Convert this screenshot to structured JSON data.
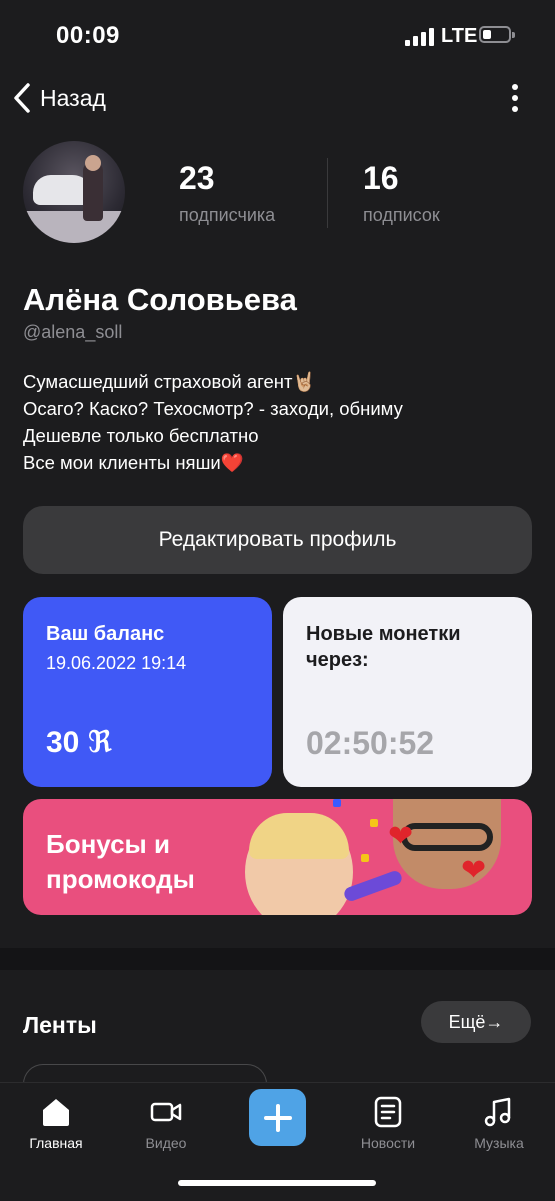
{
  "status_bar": {
    "time": "00:09",
    "network": "LTE"
  },
  "nav": {
    "back_label": "Назад"
  },
  "profile": {
    "followers_count": "23",
    "followers_label": "подписчика",
    "following_count": "16",
    "following_label": "подписок",
    "name": "Алёна Соловьева",
    "handle": "@alena_soll",
    "bio": [
      "Сумасшедший страховой агент🤘🏼",
      "Осаго? Каско? Техосмотр? - заходи, обниму",
      "Дешевле только бесплатно",
      "Все мои клиенты няши❤️"
    ],
    "edit_label": "Редактировать профиль"
  },
  "balance_card": {
    "title": "Ваш баланс",
    "date": "19.06.2022 19:14",
    "value": "30 ℜ"
  },
  "timer_card": {
    "title_line1": "Новые монетки",
    "title_line2": "через:",
    "value": "02:50:52"
  },
  "bonus_card": {
    "line1": "Бонусы и",
    "line2": "промокоды"
  },
  "feeds": {
    "title": "Ленты",
    "more_label": "Ещё→"
  },
  "tabbar": {
    "items": [
      {
        "label": "Главная",
        "icon": "home-icon"
      },
      {
        "label": "Видео",
        "icon": "video-icon"
      },
      {
        "label": "",
        "icon": "plus-icon"
      },
      {
        "label": "Новости",
        "icon": "news-icon"
      },
      {
        "label": "Музыка",
        "icon": "music-icon"
      }
    ]
  },
  "colors": {
    "balance_card": "#4059f6",
    "bonus_card": "#e94f7e",
    "plus_button": "#4fa3e6"
  }
}
